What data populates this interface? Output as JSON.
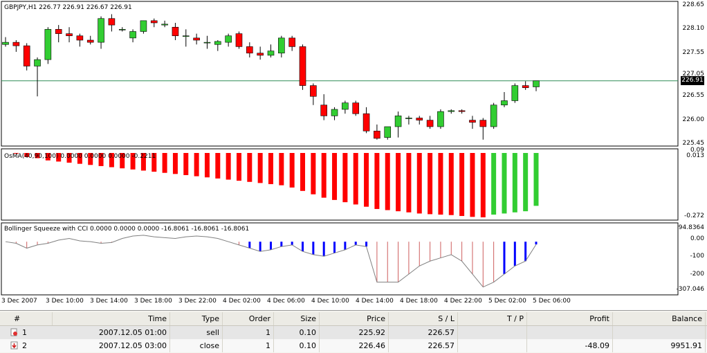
{
  "chart": {
    "main_title": "GBPJPY,H1  226.77 226.91 226.67 226.91",
    "osma_title": "OsMA(40,90,100) 0.0000 0.0000 0.0000 -0.2211",
    "squeeze_title": "Bollinger Squeeze with CCI 0.0000 0.0000 0.0000 -16.8061 -16.8061 -16.8061",
    "current_price": "226.91",
    "price_labels": [
      "228.65",
      "228.10",
      "227.55",
      "227.05",
      "226.55",
      "226.00",
      "225.45"
    ],
    "osma_labels": [
      "0.09",
      "0.013",
      "-0.272"
    ],
    "squeeze_labels": [
      "94.8364",
      "0.00",
      "-100",
      "-200",
      "-307.046"
    ],
    "time_labels": [
      "3 Dec 2007",
      "3 Dec 10:00",
      "3 Dec 14:00",
      "3 Dec 18:00",
      "3 Dec 22:00",
      "4 Dec 02:00",
      "4 Dec 06:00",
      "4 Dec 10:00",
      "4 Dec 14:00",
      "4 Dec 18:00",
      "4 Dec 22:00",
      "5 Dec 02:00",
      "5 Dec 06:00"
    ],
    "colors": {
      "bull": "#32cd32",
      "bear": "#ff0000",
      "cci_pos": "#0000ff",
      "cci_neg": "#cd5c5c",
      "line": "#7f7f7f",
      "grid": "#c0c0c0"
    }
  },
  "chart_data": {
    "type": "candlestick",
    "symbol": "GBPJPY",
    "timeframe": "H1",
    "ohlc": [
      [
        227.75,
        227.92,
        227.7,
        227.8
      ],
      [
        227.8,
        227.85,
        227.58,
        227.72
      ],
      [
        227.72,
        227.78,
        227.15,
        227.25
      ],
      [
        227.25,
        227.45,
        226.55,
        227.4
      ],
      [
        227.4,
        228.15,
        227.3,
        228.1
      ],
      [
        228.1,
        228.2,
        227.8,
        228.0
      ],
      [
        228.0,
        228.15,
        227.8,
        227.95
      ],
      [
        227.95,
        228.0,
        227.7,
        227.85
      ],
      [
        227.85,
        227.95,
        227.75,
        227.8
      ],
      [
        227.8,
        228.4,
        227.65,
        228.35
      ],
      [
        228.35,
        228.45,
        228.05,
        228.2
      ],
      [
        228.1,
        228.15,
        228.05,
        228.1
      ],
      [
        227.9,
        228.1,
        227.8,
        228.05
      ],
      [
        228.05,
        228.3,
        228.0,
        228.3
      ],
      [
        228.3,
        228.35,
        228.15,
        228.25
      ],
      [
        228.2,
        228.3,
        228.15,
        228.22
      ],
      [
        228.15,
        228.25,
        227.85,
        227.95
      ],
      [
        227.95,
        228.1,
        227.7,
        227.95
      ],
      [
        227.9,
        228.0,
        227.75,
        227.85
      ],
      [
        227.8,
        227.95,
        227.65,
        227.8
      ],
      [
        227.75,
        227.85,
        227.6,
        227.82
      ],
      [
        227.8,
        228.0,
        227.7,
        227.95
      ],
      [
        228.0,
        228.05,
        227.65,
        227.7
      ],
      [
        227.7,
        227.8,
        227.45,
        227.55
      ],
      [
        227.55,
        227.7,
        227.4,
        227.5
      ],
      [
        227.5,
        227.75,
        227.45,
        227.6
      ],
      [
        227.55,
        227.95,
        227.45,
        227.9
      ],
      [
        227.9,
        227.95,
        227.6,
        227.7
      ],
      [
        227.7,
        227.75,
        226.7,
        226.8
      ],
      [
        226.8,
        226.85,
        226.35,
        226.55
      ],
      [
        226.35,
        226.6,
        226.0,
        226.1
      ],
      [
        226.1,
        226.3,
        226.0,
        226.25
      ],
      [
        226.25,
        226.45,
        226.15,
        226.4
      ],
      [
        226.4,
        226.45,
        226.1,
        226.15
      ],
      [
        226.15,
        226.3,
        225.7,
        225.75
      ],
      [
        225.75,
        225.9,
        225.55,
        225.58
      ],
      [
        225.6,
        225.85,
        225.55,
        225.85
      ],
      [
        225.85,
        226.2,
        225.6,
        226.1
      ],
      [
        226.05,
        226.1,
        225.9,
        226.05
      ],
      [
        226.05,
        226.1,
        225.9,
        226.0
      ],
      [
        226.0,
        226.1,
        225.8,
        225.85
      ],
      [
        225.85,
        226.25,
        225.8,
        226.2
      ],
      [
        226.2,
        226.25,
        226.15,
        226.22
      ],
      [
        226.22,
        226.25,
        226.15,
        226.2
      ],
      [
        226.0,
        226.1,
        225.8,
        225.95
      ],
      [
        226.0,
        226.05,
        225.55,
        225.85
      ],
      [
        225.85,
        226.4,
        225.8,
        226.35
      ],
      [
        226.35,
        226.65,
        226.3,
        226.45
      ],
      [
        226.45,
        226.85,
        226.4,
        226.8
      ],
      [
        226.8,
        226.9,
        226.7,
        226.75
      ],
      [
        226.77,
        226.91,
        226.67,
        226.91
      ]
    ],
    "osma_values": [
      0.013,
      0.01,
      -0.005,
      -0.01,
      -0.02,
      -0.025,
      -0.03,
      -0.035,
      -0.04,
      -0.045,
      -0.05,
      -0.055,
      -0.06,
      -0.065,
      -0.07,
      -0.075,
      -0.08,
      -0.085,
      -0.09,
      -0.095,
      -0.1,
      -0.105,
      -0.11,
      -0.115,
      -0.12,
      -0.125,
      -0.13,
      -0.14,
      -0.155,
      -0.17,
      -0.185,
      -0.195,
      -0.205,
      -0.215,
      -0.225,
      -0.235,
      -0.24,
      -0.245,
      -0.25,
      -0.255,
      -0.258,
      -0.26,
      -0.262,
      -0.266,
      -0.27,
      -0.272,
      -0.26,
      -0.255,
      -0.25,
      -0.245,
      -0.2211
    ],
    "osma_colors": [
      "red",
      "red",
      "red",
      "red",
      "red",
      "red",
      "red",
      "red",
      "red",
      "red",
      "red",
      "red",
      "red",
      "red",
      "red",
      "red",
      "red",
      "red",
      "red",
      "red",
      "red",
      "red",
      "red",
      "red",
      "red",
      "red",
      "red",
      "red",
      "red",
      "red",
      "red",
      "red",
      "red",
      "red",
      "red",
      "red",
      "red",
      "red",
      "red",
      "red",
      "red",
      "red",
      "red",
      "red",
      "red",
      "red",
      "green",
      "green",
      "green",
      "green",
      "green"
    ],
    "cci_values": [
      0,
      -10,
      -40,
      -20,
      -10,
      10,
      20,
      5,
      0,
      -10,
      -5,
      20,
      35,
      40,
      30,
      25,
      20,
      30,
      35,
      30,
      20,
      0,
      -20,
      -40,
      -60,
      -50,
      -30,
      -20,
      -60,
      -80,
      -90,
      -70,
      -50,
      -20,
      -30,
      -250,
      -250,
      -250,
      -200,
      -150,
      -120,
      -100,
      -80,
      -120,
      -200,
      -280,
      -250,
      -200,
      -150,
      -120,
      -16.8061
    ],
    "cci_colors": [
      "neg",
      "neg",
      "neg",
      "neg",
      "neg",
      "pos",
      "pos",
      "pos",
      "pos",
      "neg",
      "neg",
      "pos",
      "pos",
      "pos",
      "pos",
      "pos",
      "pos",
      "pos",
      "pos",
      "pos",
      "pos",
      "neg",
      "neg",
      "pos",
      "pos",
      "pos",
      "pos",
      "pos",
      "pos",
      "pos",
      "pos",
      "pos",
      "pos",
      "pos",
      "pos",
      "neg",
      "neg",
      "neg",
      "neg",
      "neg",
      "neg",
      "neg",
      "neg",
      "neg",
      "neg",
      "neg",
      "neg",
      "pos",
      "pos",
      "pos",
      "pos"
    ],
    "price_range": [
      225.45,
      228.65
    ],
    "osma_range": [
      -0.272,
      0.013
    ],
    "squeeze_range": [
      -307.046,
      94.8364
    ]
  },
  "trades": {
    "columns": [
      "#",
      "Time",
      "Type",
      "Order",
      "Size",
      "Price",
      "S / L",
      "T / P",
      "Profit",
      "Balance"
    ],
    "rows": [
      {
        "n": "1",
        "time": "2007.12.05 01:00",
        "type": "sell",
        "order": "1",
        "size": "0.10",
        "price": "225.92",
        "sl": "226.57",
        "tp": "",
        "profit": "",
        "balance": ""
      },
      {
        "n": "2",
        "time": "2007.12.05 03:00",
        "type": "close",
        "order": "1",
        "size": "0.10",
        "price": "226.46",
        "sl": "226.57",
        "tp": "",
        "profit": "-48.09",
        "balance": "9951.91"
      }
    ]
  }
}
